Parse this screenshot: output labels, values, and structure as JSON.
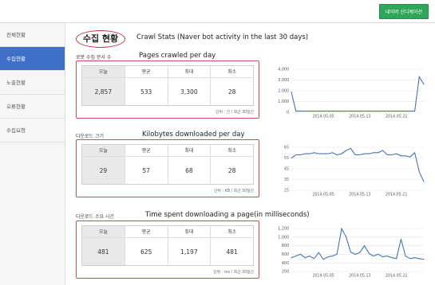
{
  "header": {
    "nav_button_label": "네이버 신디케이션"
  },
  "sidebar": {
    "items": [
      {
        "label": "전체현황",
        "active": false
      },
      {
        "label": "수집현황",
        "active": true
      },
      {
        "label": "노출현황",
        "active": false
      },
      {
        "label": "오류현황",
        "active": false
      },
      {
        "label": "수집요청",
        "active": false
      }
    ]
  },
  "page": {
    "title": "수집 현황",
    "subtitle": "Crawl Stats (Naver bot activity in the last 30 days)"
  },
  "sections": [
    {
      "label_ko": "로봇 수집 문서 수",
      "title": "Pages crawled per day",
      "headers": [
        "오늘",
        "평균",
        "최대",
        "최소"
      ],
      "values": [
        "2,857",
        "533",
        "3,300",
        "28"
      ],
      "note": "단위 : 건 / 최근 30일간"
    },
    {
      "label_ko": "다운로드 크기",
      "title": "Kilobytes downloaded per day",
      "headers": [
        "오늘",
        "평균",
        "최대",
        "최소"
      ],
      "values": [
        "29",
        "57",
        "68",
        "28"
      ],
      "note": "단위 : KB / 최근 30일간"
    },
    {
      "label_ko": "다운로드 소요 시간",
      "title": "Time spent downloading a page(in milliseconds)",
      "headers": [
        "오늘",
        "평균",
        "최대",
        "최소"
      ],
      "values": [
        "481",
        "625",
        "1,197",
        "481"
      ],
      "note": "단위 : ms / 최근 30일간"
    }
  ],
  "chart_data": [
    {
      "type": "line",
      "series_color": "#4a72b0",
      "ylim": [
        0,
        4000
      ],
      "yticks": [
        "0",
        "1,000",
        "2,000",
        "3,000",
        "4,000"
      ],
      "xticks": [
        "2014.05.05",
        "2014.05.13",
        "2014.05.21"
      ],
      "grid": true,
      "values": [
        1900,
        100,
        100,
        100,
        100,
        100,
        100,
        100,
        100,
        100,
        100,
        100,
        100,
        100,
        100,
        100,
        100,
        100,
        100,
        100,
        100,
        100,
        100,
        100,
        100,
        100,
        100,
        100,
        3300,
        2600
      ]
    },
    {
      "type": "line",
      "series_color": "#4a72b0",
      "ylim": [
        25,
        65
      ],
      "yticks": [
        "25",
        "35",
        "45",
        "55",
        "65"
      ],
      "xticks": [
        "2014.05.05",
        "2014.05.13",
        "2014.05.21"
      ],
      "grid": true,
      "values": [
        55,
        58,
        58,
        59,
        59,
        60,
        59,
        59,
        59,
        60,
        58,
        59,
        62,
        64,
        58,
        58,
        59,
        59,
        60,
        60,
        62,
        58,
        58,
        59,
        57,
        57,
        56,
        60,
        42,
        33
      ]
    },
    {
      "type": "line",
      "series_color": "#4a72b0",
      "ylim": [
        200,
        1200
      ],
      "yticks": [
        "200",
        "400",
        "600",
        "800",
        "1,000",
        "1,200"
      ],
      "xticks": [
        "2014.05.05",
        "2014.05.13",
        "2014.05.21"
      ],
      "grid": true,
      "values": [
        520,
        560,
        600,
        520,
        560,
        500,
        640,
        480,
        540,
        560,
        600,
        1197,
        1000,
        650,
        600,
        640,
        800,
        620,
        560,
        600,
        540,
        560,
        520,
        500,
        950,
        560,
        500,
        520,
        500,
        481
      ]
    }
  ]
}
